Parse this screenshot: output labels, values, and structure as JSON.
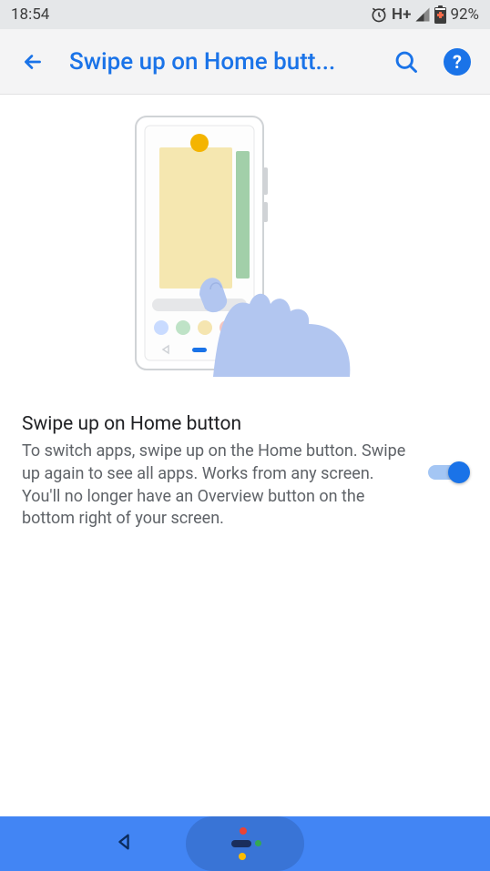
{
  "status_bar": {
    "time": "18:54",
    "network": "H+",
    "battery_pct": "92%"
  },
  "app_bar": {
    "title": "Swipe up on Home butt..."
  },
  "setting": {
    "title": "Swipe up on Home button",
    "description": "To switch apps, swipe up on the Home button. Swipe up again to see all apps. Works from any screen. You'll no longer have an Overview button on the bottom right of your screen.",
    "toggle_on": true
  }
}
